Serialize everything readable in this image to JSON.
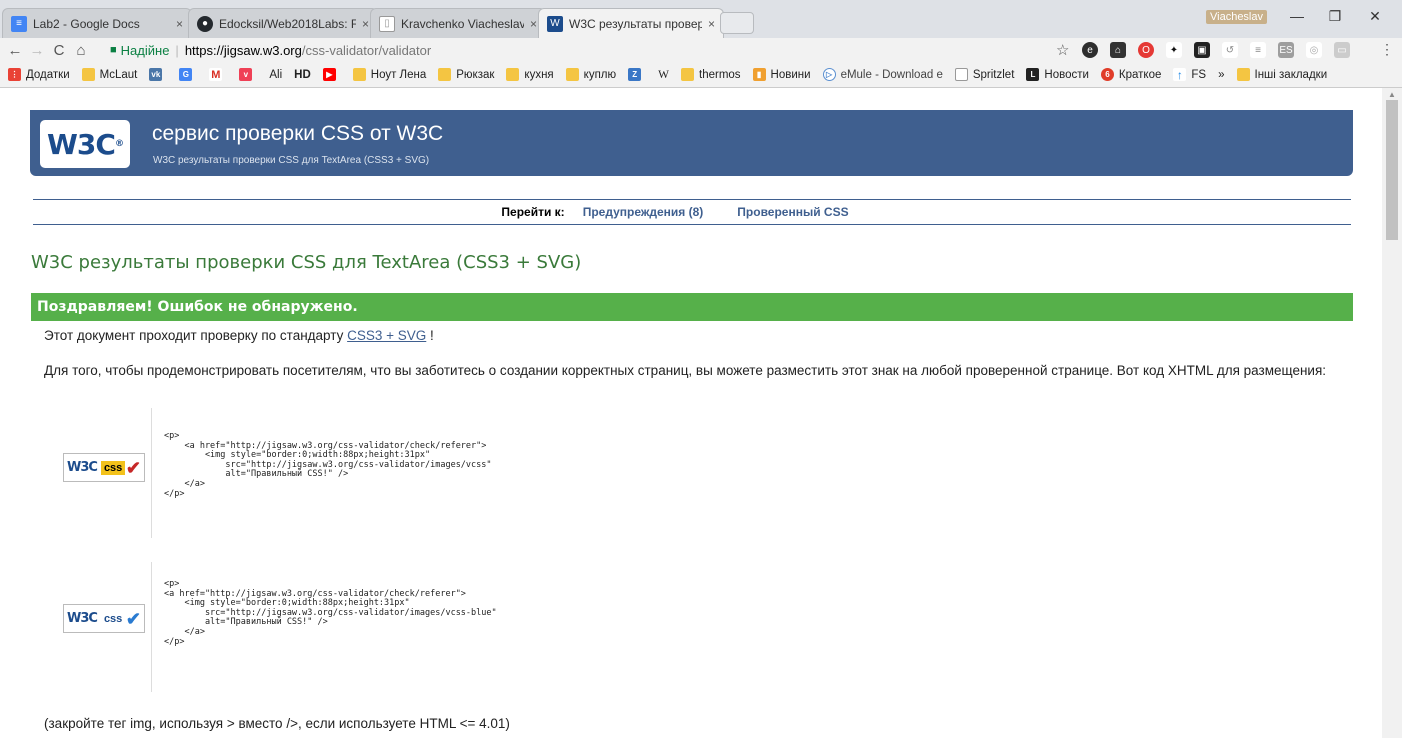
{
  "tabs": [
    {
      "title": "Lab2 - Google Docs",
      "color": "#4285f4",
      "icon": "docs-icon"
    },
    {
      "title": "Edocksil/Web2018Labs: F",
      "color": "#24292e",
      "icon": "github-icon"
    },
    {
      "title": "Kravchenko Viacheslav",
      "color": "#9e9e9e",
      "icon": "page-icon"
    },
    {
      "title": "W3C результаты провер",
      "color": "#1c4c8c",
      "icon": "w3c-icon"
    }
  ],
  "tab_close": "×",
  "profile_name": "Viacheslav",
  "window": {
    "minimize": "—",
    "restore": "❐",
    "close": "✕"
  },
  "nav": {
    "back": "←",
    "forward": "→",
    "reload": "C",
    "home": "⌂"
  },
  "omnibox": {
    "secure_label": "Надійне",
    "host": "https://jigsaw.w3.org",
    "path": "/css-validator/validator"
  },
  "star": "☆",
  "menu": "⋮",
  "bookmarks": [
    {
      "label": "Додатки",
      "icon": "apps-icon",
      "color": "#e94235"
    },
    {
      "label": "McLaut",
      "icon": "folder-icon",
      "color": "#f4c542"
    },
    {
      "label": "",
      "icon": "vk-icon",
      "color": "#4a76a8"
    },
    {
      "label": "",
      "icon": "translate-icon",
      "color": "#4285f4"
    },
    {
      "label": "",
      "icon": "gmail-icon",
      "color": "#d93025"
    },
    {
      "label": "",
      "icon": "pocket-icon",
      "color": "#ef4056"
    },
    {
      "label": "Ali",
      "icon": "ali-icon",
      "color": "#ffffff"
    },
    {
      "label": "HD",
      "icon": "hd-icon",
      "color": "#ffffff"
    },
    {
      "label": "",
      "icon": "youtube-icon",
      "color": "#ff0000"
    },
    {
      "label": "Ноут Лена",
      "icon": "folder-icon",
      "color": "#f4c542"
    },
    {
      "label": "Рюкзак",
      "icon": "folder-icon",
      "color": "#f4c542"
    },
    {
      "label": "кухня",
      "icon": "folder-icon",
      "color": "#f4c542"
    },
    {
      "label": "куплю",
      "icon": "folder-icon",
      "color": "#f4c542"
    },
    {
      "label": "",
      "icon": "slando-icon",
      "color": "#3a77c6"
    },
    {
      "label": "W",
      "icon": "wiki-icon",
      "color": "#ffffff"
    },
    {
      "label": "thermos",
      "icon": "folder-icon",
      "color": "#f4c542"
    },
    {
      "label": "Новини",
      "icon": "news-icon",
      "color": "#f0a030"
    },
    {
      "label": "eMule - Download e",
      "icon": "emule-icon",
      "color": "#5a8fd0"
    },
    {
      "label": "Spritzlet",
      "icon": "page-icon",
      "color": "#9e9e9e"
    },
    {
      "label": "Новости",
      "icon": "l-icon",
      "color": "#222222"
    },
    {
      "label": "Краткое",
      "icon": "six-icon",
      "color": "#e03c28"
    },
    {
      "label": "FS",
      "icon": "arrow-up-icon",
      "color": "#1e88e5"
    },
    {
      "label": "»",
      "icon": "",
      "color": ""
    },
    {
      "label": "Інші закладки",
      "icon": "folder-icon",
      "color": "#f4c542"
    }
  ],
  "banner": {
    "logo": "W3C",
    "logo_mark": "®",
    "title": "сервис проверки CSS от W3C",
    "subtitle": "W3C результаты проверки CSS для TextArea (CSS3 + SVG)"
  },
  "jump": {
    "label": "Перейти к:",
    "warnings": "Предупреждения (8)",
    "checked_css": "Проверенный CSS"
  },
  "results_title": "W3C результаты проверки CSS для TextArea (CSS3 + SVG)",
  "congrats": "Поздравляем! Ошибок не обнаружено.",
  "p1": {
    "before": "Этот документ проходит проверку по стандарту ",
    "link": "CSS3 + SVG",
    "after": " !"
  },
  "p2": "Для того, чтобы продемонстрировать посетителям, что вы заботитесь о создании корректных страниц, вы можете разместить этот знак на любой проверенной странице. Вот код XHTML для размещения:",
  "badges": [
    {
      "w3": "W3C",
      "css": "css",
      "check": "✔"
    },
    {
      "w3": "W3C",
      "css": "css",
      "check": "✔"
    }
  ],
  "code1": "<p>\n    <a href=\"http://jigsaw.w3.org/css-validator/check/referer\">\n        <img style=\"border:0;width:88px;height:31px\"\n            src=\"http://jigsaw.w3.org/css-validator/images/vcss\"\n            alt=\"Правильный CSS!\" />\n    </a>\n</p>",
  "code2": "<p>\n<a href=\"http://jigsaw.w3.org/css-validator/check/referer\">\n    <img style=\"border:0;width:88px;height:31px\"\n        src=\"http://jigsaw.w3.org/css-validator/images/vcss-blue\"\n        alt=\"Правильный CSS!\" />\n    </a>\n</p>",
  "p3": "(закройте тег img, используя > вместо />, если используете HTML <= 4.01)"
}
